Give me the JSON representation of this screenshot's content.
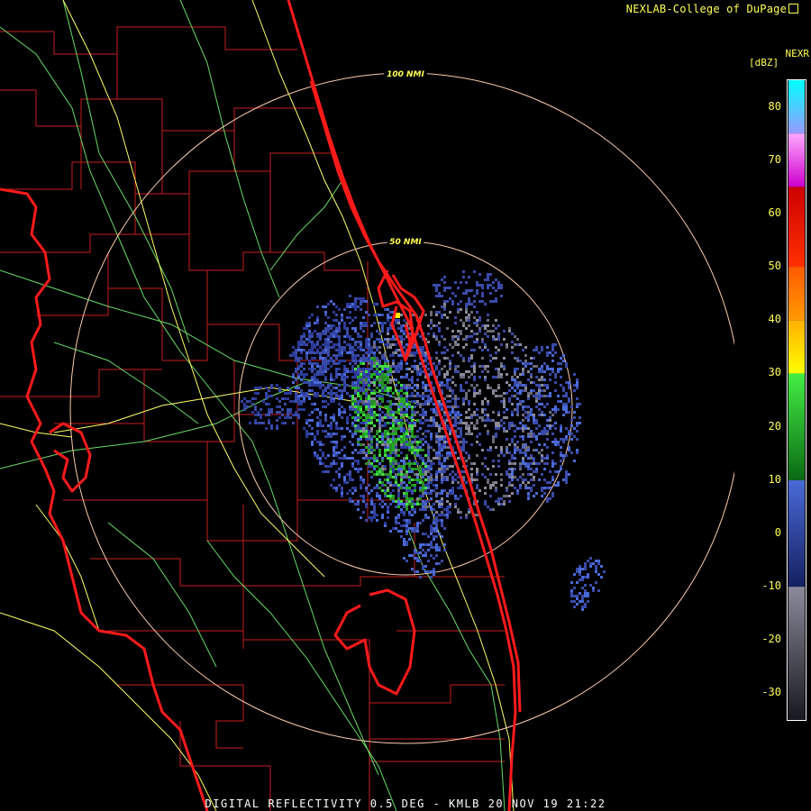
{
  "header": {
    "credit": "NEXLAB-College of DuPage",
    "product_code": "NEXR",
    "unit": "[dBZ]"
  },
  "range_rings": [
    {
      "label": "100 NMI"
    },
    {
      "label": "50 NMI"
    }
  ],
  "legend": {
    "ticks": [
      "80",
      "70",
      "60",
      "50",
      "40",
      "30",
      "20",
      "10",
      "0",
      "-10",
      "-20",
      "-30"
    ],
    "bands": [
      {
        "from": -35,
        "to": -10,
        "color_top": "#8a8a9a",
        "color_bottom": "#181820"
      },
      {
        "from": -10,
        "to": 10,
        "color_top": "#4a6ad8",
        "color_bottom": "#142060"
      },
      {
        "from": 10,
        "to": 30,
        "color_top": "#44ee44",
        "color_bottom": "#0a6a14"
      },
      {
        "from": 30,
        "to": 40,
        "color_top": "#ffb000",
        "color_bottom": "#ffff00"
      },
      {
        "from": 40,
        "to": 50,
        "color_top": "#ff5a00",
        "color_bottom": "#ff9a00"
      },
      {
        "from": 50,
        "to": 65,
        "color_top": "#cc0000",
        "color_bottom": "#ff3000"
      },
      {
        "from": 65,
        "to": 75,
        "color_top": "#ffaaff",
        "color_bottom": "#cc00cc"
      },
      {
        "from": 75,
        "to": 85,
        "color_top": "#00ffff",
        "color_bottom": "#9999ff"
      }
    ]
  },
  "colors": {
    "coastline": "#ff1a1a",
    "county": "#c81e1e",
    "highway": "#ffff66",
    "road": "#66dd66",
    "ring": "#ffccaa",
    "label": "#ffff55"
  },
  "footer": {
    "caption": "DIGITAL REFLECTIVITY 0.5 DEG - KMLB 20 NOV 19 21:22"
  }
}
